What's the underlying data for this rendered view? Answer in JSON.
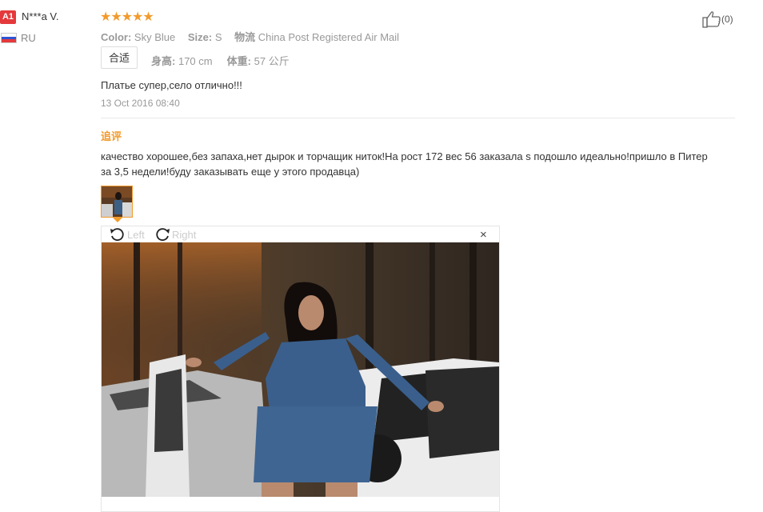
{
  "reviewer": {
    "level_badge": "A1",
    "name": "N***a V.",
    "country": "RU",
    "flag_colors": [
      "#ffffff",
      "#2f55d4",
      "#e4393c"
    ]
  },
  "review": {
    "rating_stars": 5,
    "stars_text": "★★★★★",
    "color_label": "Color:",
    "color_value": "Sky Blue",
    "size_label": "Size:",
    "size_value": "S",
    "shipping_label": "物流",
    "shipping_value": "China Post Registered Air Mail",
    "fit_button": "合适",
    "height_label": "身高:",
    "height_value": "170 cm",
    "weight_label": "体重:",
    "weight_value": "57 公斤",
    "text": "Платье супер,село отлично!!!",
    "date": "13 Oct 2016 08:40"
  },
  "followup": {
    "label": "追评",
    "text": "качество хорошее,без запаха,нет дырок и торчащик ниток!На рост 172 вес 56 заказала s подошло идеально!пришло в Питер за 3,5 недели!буду заказывать еще у этого продавца)"
  },
  "viewer": {
    "rotate_left": "Left",
    "rotate_right": "Right",
    "close": "×"
  },
  "like": {
    "count": "(0)"
  },
  "colors": {
    "accent": "#f29a2b",
    "badge": "#e4393c",
    "muted": "#999999"
  }
}
